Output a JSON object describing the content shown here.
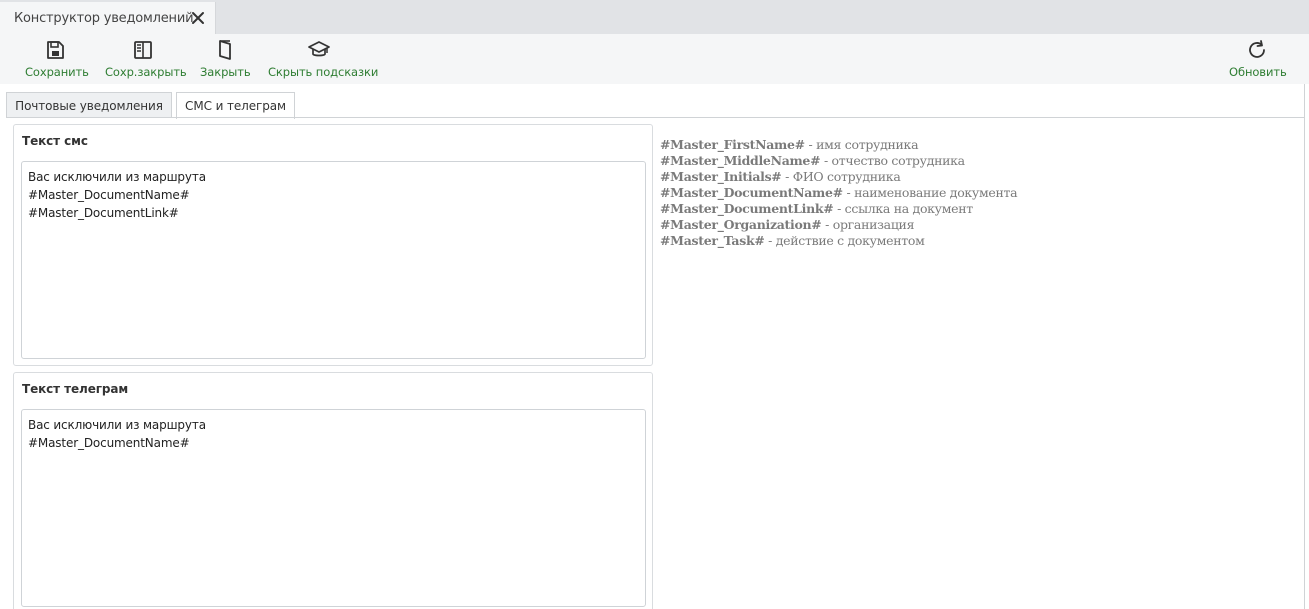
{
  "window": {
    "tab_title": "Конструктор уведомлений",
    "close_icon": "close-icon"
  },
  "toolbar": {
    "accent_color": "#2e7d32",
    "save_label": "Сохранить",
    "save_close_label": "Сохр.закрыть",
    "close_label": "Закрыть",
    "hide_hints_label": "Скрыть подсказки",
    "refresh_label": "Обновить",
    "icons": [
      "save-icon",
      "save-close-icon",
      "door-icon",
      "graduation-cap-icon",
      "refresh-icon"
    ]
  },
  "tabs": [
    {
      "label": "Почтовые уведомления",
      "active": false
    },
    {
      "label": "СМС и телеграм",
      "active": true
    }
  ],
  "sms": {
    "title": "Текст смс",
    "text": "Вас исключили из маршрута\n#Master_DocumentName#\n#Master_DocumentLink#"
  },
  "telegram": {
    "title": "Текст телеграм",
    "text": "Вас исключили из маршрута\n#Master_DocumentName#"
  },
  "hints": [
    {
      "code": "#Master_FirstName#",
      "desc": " - имя сотрудника"
    },
    {
      "code": "#Master_MiddleName#",
      "desc": " - отчество сотрудника"
    },
    {
      "code": "#Master_Initials#",
      "desc": " - ФИО сотрудника"
    },
    {
      "code": "#Master_DocumentName#",
      "desc": " - наименование документа"
    },
    {
      "code": "#Master_DocumentLink#",
      "desc": " - ссылка на документ"
    },
    {
      "code": "#Master_Organization#",
      "desc": " - организация"
    },
    {
      "code": "#Master_Task#",
      "desc": " - действие с документом"
    }
  ]
}
